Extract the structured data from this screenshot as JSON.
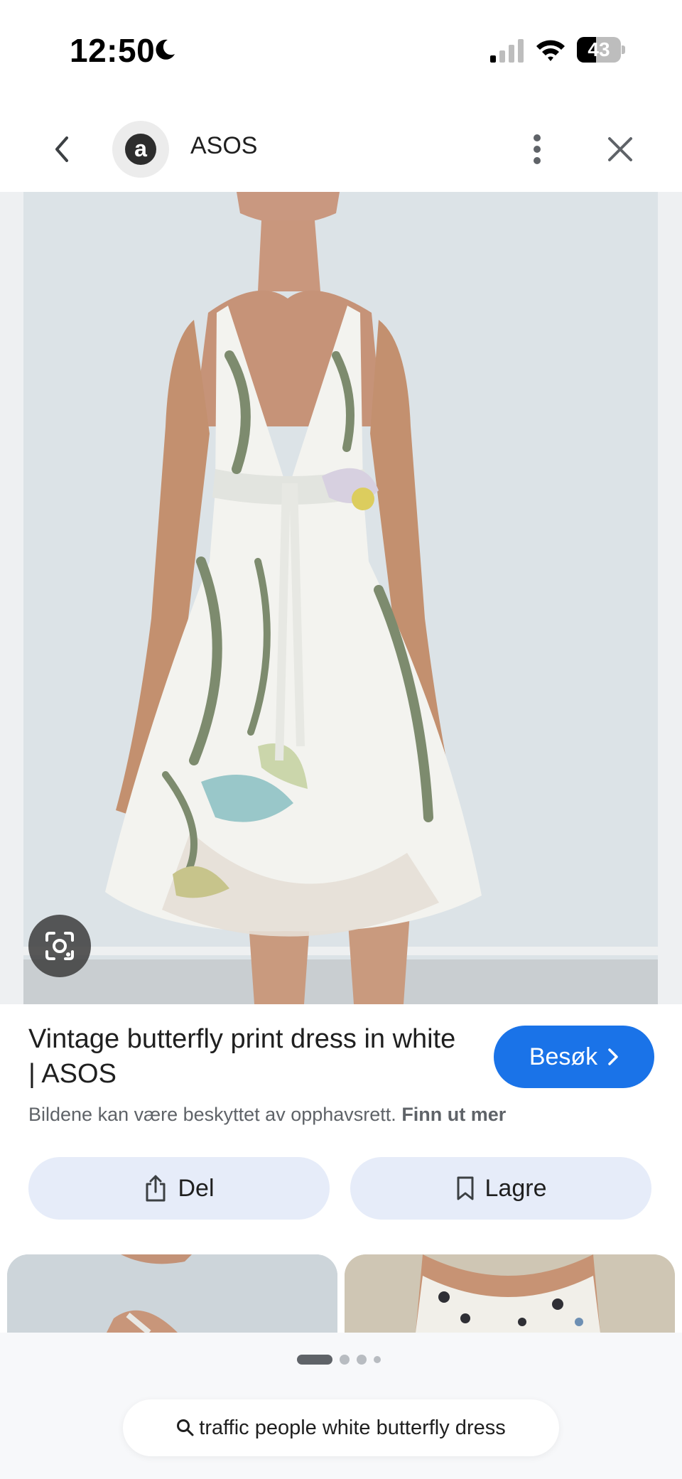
{
  "status_bar": {
    "time": "12:50",
    "battery_percent": "43",
    "battery_level": 0.43,
    "icons": [
      "moon-icon",
      "signal-icon",
      "wifi-icon",
      "battery-icon"
    ]
  },
  "header": {
    "site_logo_letter": "a",
    "site_name": "ASOS",
    "icons": [
      "chevron-left-icon",
      "more-vertical-icon",
      "close-icon"
    ]
  },
  "result": {
    "title": "Vintage butterfly print dress in white | ASOS",
    "visit_label": "Besøk",
    "copyright_text": "Bildene kan være beskyttet av opphavsrett.",
    "copyright_link": "Finn ut mer",
    "lens_icon": "lens-icon"
  },
  "actions": {
    "share_label": "Del",
    "save_label": "Lagre",
    "icons": [
      "share-icon",
      "bookmark-icon"
    ]
  },
  "pager": {
    "count": 4,
    "active": 0
  },
  "search": {
    "query": "traffic people white butterfly dress",
    "icon": "search-icon"
  },
  "colors": {
    "accent": "#1a73e8",
    "action_button_bg": "#e6ecf9",
    "muted_text": "#5f6368"
  }
}
